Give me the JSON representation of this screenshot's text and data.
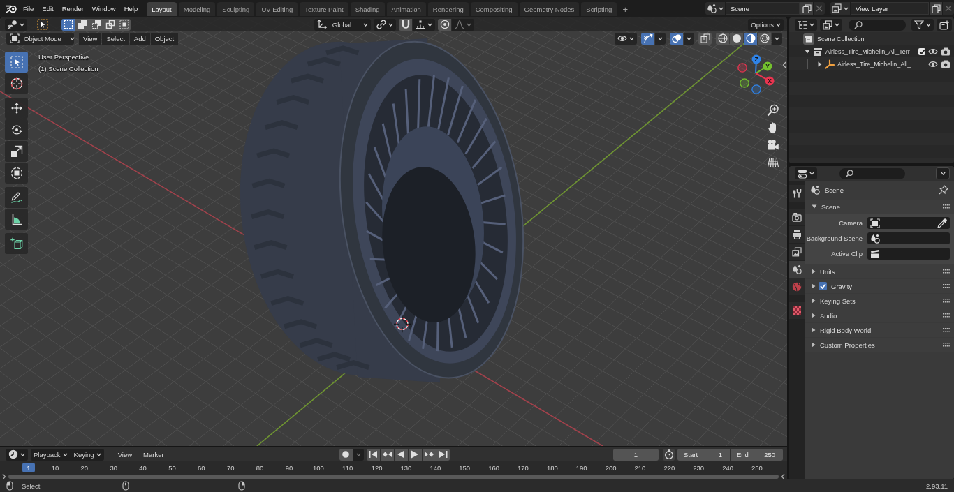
{
  "topbar": {
    "menus": [
      "File",
      "Edit",
      "Render",
      "Window",
      "Help"
    ],
    "workspaces": [
      {
        "label": "Layout",
        "selected": true
      },
      {
        "label": "Modeling",
        "selected": false
      },
      {
        "label": "Sculpting",
        "selected": false
      },
      {
        "label": "UV Editing",
        "selected": false
      },
      {
        "label": "Texture Paint",
        "selected": false
      },
      {
        "label": "Shading",
        "selected": false
      },
      {
        "label": "Animation",
        "selected": false
      },
      {
        "label": "Rendering",
        "selected": false
      },
      {
        "label": "Compositing",
        "selected": false
      },
      {
        "label": "Geometry Nodes",
        "selected": false
      },
      {
        "label": "Scripting",
        "selected": false
      }
    ],
    "add_tab": "+",
    "scene": "Scene",
    "view_layer": "View Layer"
  },
  "tool_header": {
    "select_modes": [
      {
        "kind": "set",
        "selected": true
      },
      {
        "kind": "extend",
        "selected": false
      },
      {
        "kind": "subtract",
        "selected": false
      },
      {
        "kind": "difference",
        "selected": false
      },
      {
        "kind": "intersect",
        "selected": false
      }
    ],
    "orientation": "Global",
    "snap": {
      "on": false
    },
    "proportional": {
      "on": false
    },
    "options": "Options"
  },
  "viewport_header": {
    "mode": "Object Mode",
    "menus": [
      "View",
      "Select",
      "Add",
      "Object"
    ],
    "toggles": [
      {
        "kind": "gizmo",
        "on": true
      },
      {
        "kind": "overlay",
        "on": true
      },
      {
        "kind": "xray",
        "on": false
      }
    ],
    "shading": [
      {
        "kind": "wireframe",
        "selected": false
      },
      {
        "kind": "solid",
        "selected": false
      },
      {
        "kind": "material",
        "selected": true
      },
      {
        "kind": "rendered",
        "selected": false
      }
    ]
  },
  "viewport": {
    "info": [
      "User Perspective",
      "(1) Scene Collection"
    ],
    "tool_groups": [
      {
        "tools": [
          {
            "kind": "select",
            "selected": true
          },
          {
            "kind": "cursor",
            "selected": false
          }
        ]
      },
      {
        "tools": [
          {
            "kind": "move",
            "selected": false
          },
          {
            "kind": "rotate",
            "selected": false
          },
          {
            "kind": "scale",
            "selected": false
          },
          {
            "kind": "transform",
            "selected": false
          }
        ]
      },
      {
        "tools": [
          {
            "kind": "annotate",
            "selected": false
          },
          {
            "kind": "measure",
            "selected": false
          }
        ]
      },
      {
        "tools": [
          {
            "kind": "add_cube",
            "selected": false
          }
        ]
      }
    ],
    "gizmo_axes": [
      {
        "label": "Z",
        "color": "#2f83e8"
      },
      {
        "label": "Y",
        "color": "#74c12e"
      },
      {
        "label": "X",
        "color": "#e8344f"
      }
    ]
  },
  "timeline": {
    "menus": [
      {
        "label": "Playback",
        "kind": "dropdown"
      },
      {
        "label": "Keying",
        "kind": "dropdown"
      },
      {
        "label": "View",
        "kind": "menu"
      },
      {
        "label": "Marker",
        "kind": "menu"
      }
    ],
    "auto_keying": {
      "on": false
    },
    "current_frame": "1",
    "preview_range": {
      "on": false
    },
    "start": {
      "label": "Start",
      "value": "1"
    },
    "end": {
      "label": "End",
      "value": "250"
    },
    "playhead": "1",
    "ruler": [
      "10",
      "20",
      "30",
      "40",
      "50",
      "60",
      "70",
      "80",
      "90",
      "100",
      "110",
      "120",
      "130",
      "140",
      "150",
      "160",
      "170",
      "180",
      "190",
      "200",
      "210",
      "220",
      "230",
      "240",
      "250"
    ]
  },
  "outliner": {
    "root": "Scene Collection",
    "items": [
      {
        "label": "Airless_Tire_Michelin_All_Terr",
        "kind": "collection",
        "expanded": true,
        "checked": true,
        "children": [
          {
            "label": "Airless_Tire_Michelin_All_",
            "kind": "empty",
            "expanded": false
          }
        ]
      }
    ]
  },
  "properties": {
    "tab_groups": [
      {
        "tabs": [
          {
            "kind": "tool",
            "selected": false
          }
        ]
      },
      {
        "tabs": [
          {
            "kind": "render",
            "selected": false
          },
          {
            "kind": "output",
            "selected": false
          },
          {
            "kind": "view_layer",
            "selected": false
          },
          {
            "kind": "scene",
            "selected": true
          },
          {
            "kind": "world",
            "selected": false
          }
        ]
      },
      {
        "tabs": [
          {
            "kind": "texture",
            "selected": false
          }
        ]
      }
    ],
    "context": "Scene",
    "panels": [
      {
        "title": "Scene",
        "kind": "plain",
        "expanded": true,
        "fields": [
          {
            "label": "Camera",
            "kind": "object"
          },
          {
            "label": "Background Scene",
            "kind": "scene"
          },
          {
            "label": "Active Clip",
            "kind": "clip"
          }
        ]
      },
      {
        "title": "Units",
        "kind": "plain",
        "expanded": false
      },
      {
        "title": "Gravity",
        "kind": "toggle",
        "checked": true,
        "expanded": false
      },
      {
        "title": "Keying Sets",
        "kind": "plain",
        "expanded": false
      },
      {
        "title": "Audio",
        "kind": "plain",
        "expanded": false
      },
      {
        "title": "Rigid Body World",
        "kind": "plain",
        "expanded": false
      },
      {
        "title": "Custom Properties",
        "kind": "plain",
        "expanded": false
      }
    ]
  },
  "status_bar": {
    "hint": "Select",
    "version": "2.93.11"
  }
}
